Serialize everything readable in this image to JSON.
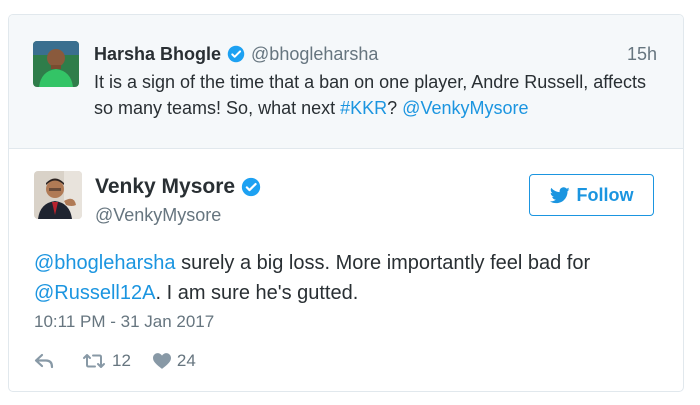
{
  "quoted_tweet": {
    "name": "Harsha Bhogle",
    "handle": "@bhogleharsha",
    "time": "15h",
    "text_before": "It is a sign of the time that a ban on one player, Andre Russell, affects so many teams! So, what next ",
    "hashtag": "#KKR",
    "text_mid": "? ",
    "mention": "@VenkyMysore"
  },
  "tweet": {
    "name": "Venky Mysore",
    "handle": "@VenkyMysore",
    "follow_label": "Follow",
    "mention1": "@bhogleharsha",
    "text_1": " surely a big loss. More importantly feel bad for ",
    "mention2": "@Russell12A",
    "text_2": ". I am sure he's gutted.",
    "timestamp": "10:11 PM - 31 Jan 2017",
    "retweets": "12",
    "likes": "24"
  },
  "colors": {
    "link": "#1b95e0",
    "muted": "#66757f",
    "text": "#292f33",
    "quoted_bg": "#f5f8fa"
  }
}
